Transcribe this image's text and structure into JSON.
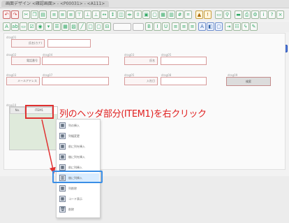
{
  "window": {
    "title": "画面デザイン <確認画面> - <P00031> - <A111>"
  },
  "form": {
    "captions": {
      "r1a": "drag01",
      "r2a": "drag02",
      "r2b": "drag04",
      "r2c": "drag03",
      "r2d": "drag05",
      "r3a": "drag03",
      "r3b": "drag07",
      "r3c": "drag05",
      "r3d": "drag08",
      "r3e": "drag09",
      "r4a": "drag10"
    },
    "labels": {
      "name_kana": "氏名(カナ)",
      "phone": "電話番号",
      "name": "氏名",
      "email": "メールアドレス",
      "date": "入社日"
    },
    "search_button": "検索"
  },
  "grid": {
    "col_no": "No.",
    "col_item1": "ITEM1"
  },
  "annotation": "列のヘッダ部分(ITEM1)を右クリック",
  "context_menu": {
    "items": [
      {
        "label": "列の挿入",
        "icon": "grid-icon"
      },
      {
        "label": "列幅変更",
        "icon": "grid-icon"
      },
      {
        "label": "前に列を挿入",
        "icon": "grid-icon"
      },
      {
        "label": "後に列を挿入",
        "icon": "grid-icon"
      },
      {
        "label": "前に列挿入",
        "icon": "grid-icon"
      },
      {
        "label": "後に列挿入",
        "icon": "column-insert-icon"
      },
      {
        "label": "列削除",
        "icon": "grid-icon"
      },
      {
        "label": "コード表示",
        "icon": "grid-icon"
      },
      {
        "label": "削除",
        "icon": "trash-icon"
      }
    ]
  }
}
